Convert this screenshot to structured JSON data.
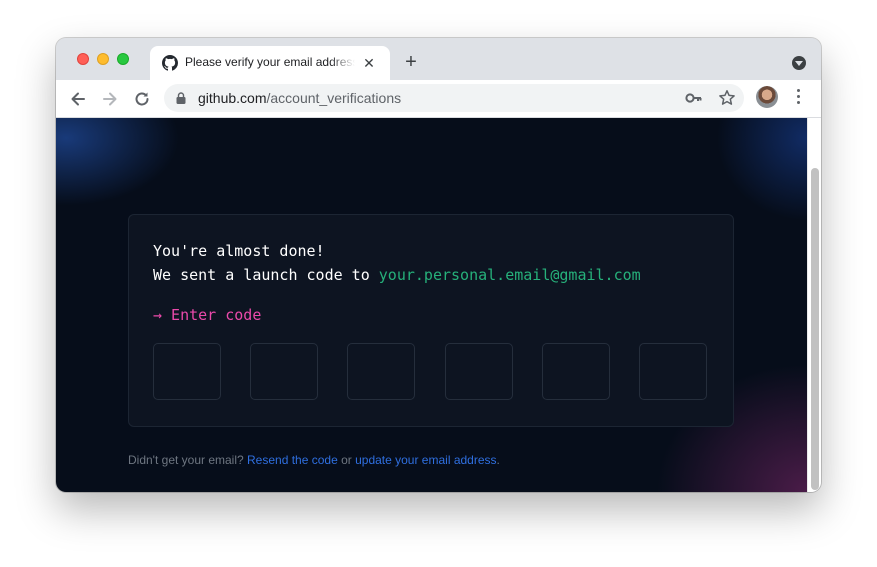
{
  "browser": {
    "tab_title": "Please verify your email address",
    "tab_close": "✕",
    "new_tab": "+",
    "url_domain": "github.com",
    "url_path": "/account_verifications"
  },
  "page": {
    "line1": "You're almost done!",
    "line2_prefix": "We sent a launch code to ",
    "email": "your.personal.email@gmail.com",
    "enter_code": "→ Enter code",
    "code_boxes": [
      "",
      "",
      "",
      "",
      "",
      ""
    ],
    "footer_prefix": "Didn't get your email? ",
    "resend_link": "Resend the code",
    "footer_or": " or ",
    "update_link": "update your email address",
    "footer_suffix": "."
  },
  "colors": {
    "page_background": "#060d1a",
    "email_green": "#26b07a",
    "enter_code_pink": "#ea4aaa",
    "link_blue": "#2f6fe0"
  },
  "icons": {
    "favicon": "github-icon",
    "back": "arrow-left-icon",
    "forward": "arrow-right-icon",
    "reload": "reload-icon",
    "lock": "lock-icon",
    "key": "key-icon",
    "bookmark": "star-icon",
    "menu": "kebab-icon"
  }
}
